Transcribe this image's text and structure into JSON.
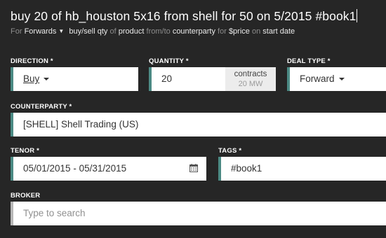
{
  "command": {
    "text": "buy 20 of hb_houston 5x16 from shell for 50 on 5/2015 #book1"
  },
  "hint": {
    "for1": "For",
    "mode": "Forwards",
    "buysell": "buy/sell",
    "qty": "qty",
    "of": "of",
    "product": "product",
    "fromto": "from/to",
    "counterparty": "counterparty",
    "for2": "for",
    "price": "$price",
    "on": "on",
    "startdate": "start date"
  },
  "direction": {
    "label": "DIRECTION *",
    "value": "Buy"
  },
  "quantity": {
    "label": "QUANTITY *",
    "value": "20",
    "unit": "contracts",
    "unit_sub": "20 MW"
  },
  "deal_type": {
    "label": "DEAL TYPE *",
    "value": "Forward"
  },
  "counterparty": {
    "label": "COUNTERPARTY *",
    "value": "[SHELL] Shell Trading (US)"
  },
  "tenor": {
    "label": "TENOR *",
    "value": "05/01/2015 - 05/31/2015"
  },
  "tags": {
    "label": "TAGS *",
    "value": "#book1"
  },
  "broker": {
    "label": "BROKER",
    "placeholder": "Type to search"
  },
  "colors": {
    "background": "#262626",
    "accent": "#4b8a84",
    "field": "#ffffff"
  },
  "icons": {
    "calendar": "calendar-icon",
    "dropdown": "chevron-down-icon"
  }
}
